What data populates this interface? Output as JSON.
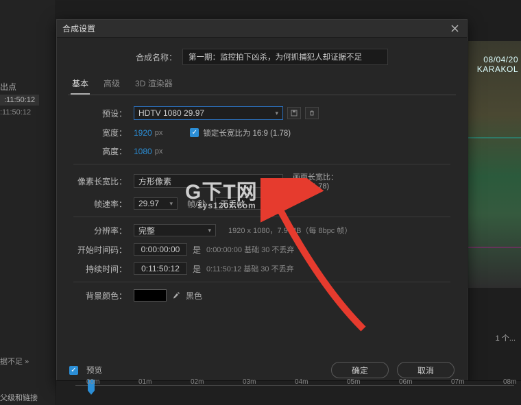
{
  "bg_left": {
    "out_label": "出点",
    "tc_sel": ":11:50:12",
    "tc_dim": ":11:50:12",
    "truncated": "据不足 »",
    "parent_link": "父级和链接"
  },
  "bg_right": {
    "timestamp_line1": "08/04/20",
    "timestamp_line2": "KARAKOL",
    "chip": "1 个..."
  },
  "dialog": {
    "title": "合成设置",
    "name_label": "合成名称：",
    "name_value": "第一期：监控拍下凶杀，为何抓捕犯人却证据不足",
    "tabs": {
      "basic": "基本",
      "advanced": "高级",
      "renderer": "3D 渲染器"
    },
    "preset": {
      "label": "预设：",
      "value": "HDTV 1080 29.97"
    },
    "width": {
      "label": "宽度：",
      "value": "1920",
      "unit": "px"
    },
    "height": {
      "label": "高度：",
      "value": "1080",
      "unit": "px"
    },
    "lock_aspect": "锁定长宽比为 16:9 (1.78)",
    "par": {
      "label": "像素长宽比：",
      "value": "方形像素",
      "side_label": "画面长宽比：",
      "side_value": "16:9 (1.78)"
    },
    "fps": {
      "label": "帧速率：",
      "value": "29.97",
      "unit": "帧/秒",
      "drop": "无丢帧"
    },
    "resolution": {
      "label": "分辨率：",
      "value": "完整",
      "info": "1920 x 1080，7.9 MB（每 8bpc 帧）"
    },
    "start_tc": {
      "label": "开始时间码：",
      "value": "0:00:00:00",
      "is": "是",
      "base": "0:00:00:00 基础 30 不丢弃"
    },
    "duration": {
      "label": "持续时间：",
      "value": "0:11:50:12",
      "is": "是",
      "base": "0:11:50:12 基础 30 不丢弃"
    },
    "bgcolor": {
      "label": "背景颜色：",
      "name": "黑色"
    },
    "preview_cb": "预览",
    "ok": "确定",
    "cancel": "取消"
  },
  "timeline": {
    "marks": [
      "00m",
      "01m",
      "02m",
      "03m",
      "04m",
      "05m",
      "06m",
      "07m",
      "08m"
    ]
  },
  "watermark": {
    "big": "G下T网",
    "sub": "sys120x.com"
  }
}
